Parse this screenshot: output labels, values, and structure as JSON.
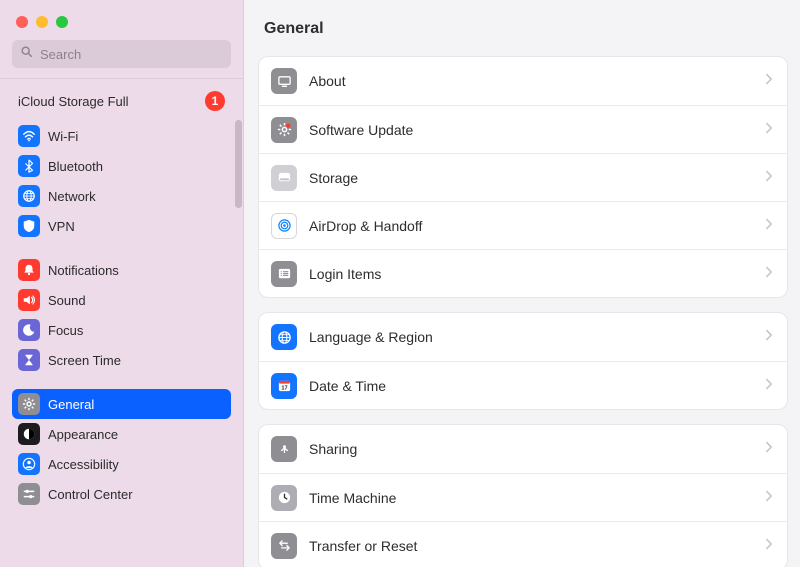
{
  "search": {
    "placeholder": "Search",
    "value": ""
  },
  "sidebar": {
    "storageBanner": {
      "label": "iCloud Storage Full",
      "badge": "1"
    },
    "items": [
      {
        "id": "wifi",
        "label": "Wi-Fi",
        "icon": "wifi-icon",
        "bg": "bg-blue"
      },
      {
        "id": "bluetooth",
        "label": "Bluetooth",
        "icon": "bluetooth-icon",
        "bg": "bg-blue"
      },
      {
        "id": "network",
        "label": "Network",
        "icon": "globe-icon",
        "bg": "bg-blue"
      },
      {
        "id": "vpn",
        "label": "VPN",
        "icon": "shield-icon",
        "bg": "bg-blue"
      },
      {
        "id": "notifications",
        "label": "Notifications",
        "icon": "bell-icon",
        "bg": "bg-red"
      },
      {
        "id": "sound",
        "label": "Sound",
        "icon": "speaker-icon",
        "bg": "bg-red"
      },
      {
        "id": "focus",
        "label": "Focus",
        "icon": "moon-icon",
        "bg": "bg-purple"
      },
      {
        "id": "screentime",
        "label": "Screen Time",
        "icon": "hourglass-icon",
        "bg": "bg-purple"
      },
      {
        "id": "general",
        "label": "General",
        "icon": "gear-icon",
        "bg": "bg-gray",
        "active": true
      },
      {
        "id": "appearance",
        "label": "Appearance",
        "icon": "contrast-icon",
        "bg": "bg-black"
      },
      {
        "id": "accessibility",
        "label": "Accessibility",
        "icon": "person-icon",
        "bg": "bg-blue"
      },
      {
        "id": "controlcenter",
        "label": "Control Center",
        "icon": "sliders-icon",
        "bg": "bg-gray"
      }
    ]
  },
  "main": {
    "title": "General",
    "groups": [
      [
        {
          "id": "about",
          "label": "About",
          "icon": "monitor-icon",
          "bg": "bg-gray"
        },
        {
          "id": "softwareupdate",
          "label": "Software Update",
          "icon": "gear-badge-icon",
          "bg": "bg-gray"
        },
        {
          "id": "storage",
          "label": "Storage",
          "icon": "disk-icon",
          "bg": "bg-lgray"
        },
        {
          "id": "airdrop",
          "label": "AirDrop & Handoff",
          "icon": "airdrop-icon",
          "bg": "bg-white"
        },
        {
          "id": "loginitems",
          "label": "Login Items",
          "icon": "list-icon",
          "bg": "bg-gray"
        }
      ],
      [
        {
          "id": "language",
          "label": "Language & Region",
          "icon": "globe-icon",
          "bg": "bg-blue"
        },
        {
          "id": "datetime",
          "label": "Date & Time",
          "icon": "calendar-icon",
          "bg": "bg-blue"
        }
      ],
      [
        {
          "id": "sharing",
          "label": "Sharing",
          "icon": "share-icon",
          "bg": "bg-gray"
        },
        {
          "id": "timemachine",
          "label": "Time Machine",
          "icon": "clock-icon",
          "bg": "bg-metal"
        },
        {
          "id": "transfer",
          "label": "Transfer or Reset",
          "icon": "arrows-icon",
          "bg": "bg-gray"
        }
      ]
    ]
  }
}
